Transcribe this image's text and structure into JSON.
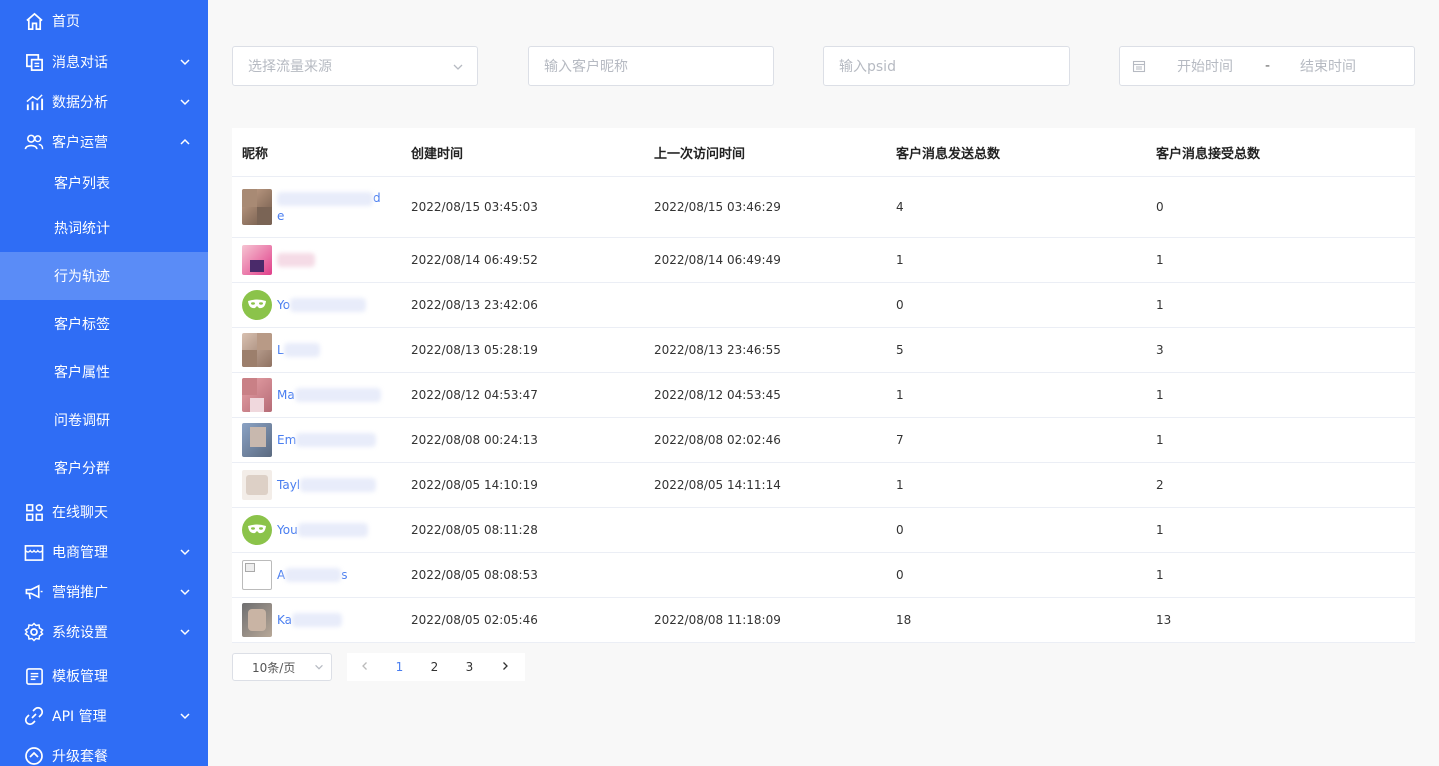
{
  "sidebar": {
    "items": [
      {
        "label": "首页"
      },
      {
        "label": "消息对话"
      },
      {
        "label": "数据分析"
      },
      {
        "label": "客户运营"
      },
      {
        "label": "在线聊天"
      },
      {
        "label": "电商管理"
      },
      {
        "label": "营销推广"
      },
      {
        "label": "系统设置"
      },
      {
        "label": "模板管理"
      },
      {
        "label": "API 管理"
      },
      {
        "label": "升级套餐"
      }
    ],
    "sub_items": [
      {
        "label": "客户列表"
      },
      {
        "label": "热词统计"
      },
      {
        "label": "行为轨迹"
      },
      {
        "label": "客户标签"
      },
      {
        "label": "客户属性"
      },
      {
        "label": "问卷调研"
      },
      {
        "label": "客户分群"
      }
    ]
  },
  "filters": {
    "source_placeholder": "选择流量来源",
    "nickname_placeholder": "输入客户昵称",
    "psid_placeholder": "输入psid",
    "start_placeholder": "开始时间",
    "range_sep": "-",
    "end_placeholder": "结束时间"
  },
  "table": {
    "headers": [
      "昵称",
      "创建时间",
      "上一次访问时间",
      "客户消息发送总数",
      "客户消息接受总数"
    ],
    "rows": [
      {
        "nick": "",
        "nick2": "e",
        "created": "2022/08/15 03:45:03",
        "last": "2022/08/15 03:46:29",
        "sent": "4",
        "recv": "0"
      },
      {
        "nick": "",
        "created": "2022/08/14 06:49:52",
        "last": "2022/08/14 06:49:49",
        "sent": "1",
        "recv": "1"
      },
      {
        "nick": "Yo",
        "created": "2022/08/13 23:42:06",
        "last": "",
        "sent": "0",
        "recv": "1"
      },
      {
        "nick": "L",
        "created": "2022/08/13 05:28:19",
        "last": "2022/08/13 23:46:55",
        "sent": "5",
        "recv": "3"
      },
      {
        "nick": "Ma",
        "created": "2022/08/12 04:53:47",
        "last": "2022/08/12 04:53:45",
        "sent": "1",
        "recv": "1"
      },
      {
        "nick": "Em",
        "created": "2022/08/08 00:24:13",
        "last": "2022/08/08 02:02:46",
        "sent": "7",
        "recv": "1"
      },
      {
        "nick": "Tayl",
        "created": "2022/08/05 14:10:19",
        "last": "2022/08/05 14:11:14",
        "sent": "1",
        "recv": "2"
      },
      {
        "nick": "You",
        "created": "2022/08/05 08:11:28",
        "last": "",
        "sent": "0",
        "recv": "1"
      },
      {
        "nick": "A",
        "nick2": "s",
        "created": "2022/08/05 08:08:53",
        "last": "",
        "sent": "0",
        "recv": "1"
      },
      {
        "nick": "Ka",
        "created": "2022/08/05 02:05:46",
        "last": "2022/08/08 11:18:09",
        "sent": "18",
        "recv": "13"
      }
    ]
  },
  "pagination": {
    "page_size": "10条/页",
    "pages": [
      "1",
      "2",
      "3"
    ],
    "current": "1"
  },
  "colors": {
    "sidebar_bg": "#2f6df5",
    "sidebar_active": "#5a8cf7",
    "link": "#4a7ef0"
  }
}
